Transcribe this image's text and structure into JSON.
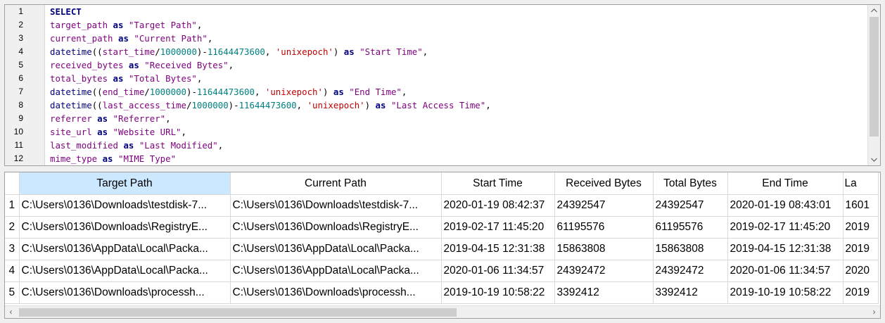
{
  "editor": {
    "line_numbers": [
      "1",
      "2",
      "3",
      "4",
      "5",
      "6",
      "7",
      "8",
      "9",
      "10",
      "11",
      "12"
    ],
    "lines": [
      [
        {
          "t": "SELECT",
          "c": "kw"
        }
      ],
      [
        {
          "t": "target_path",
          "c": "id"
        },
        {
          "t": " as ",
          "c": "kw"
        },
        {
          "t": "\"Target Path\"",
          "c": "str"
        },
        {
          "t": ",",
          "c": "op"
        }
      ],
      [
        {
          "t": "current_path",
          "c": "id"
        },
        {
          "t": " as ",
          "c": "kw"
        },
        {
          "t": "\"Current Path\"",
          "c": "str"
        },
        {
          "t": ",",
          "c": "op"
        }
      ],
      [
        {
          "t": "datetime",
          "c": "fn"
        },
        {
          "t": "((",
          "c": "op"
        },
        {
          "t": "start_time",
          "c": "id"
        },
        {
          "t": "/",
          "c": "op"
        },
        {
          "t": "1000000",
          "c": "num"
        },
        {
          "t": ")-",
          "c": "op"
        },
        {
          "t": "11644473600",
          "c": "num"
        },
        {
          "t": ", ",
          "c": "op"
        },
        {
          "t": "'unixepoch'",
          "c": "sq"
        },
        {
          "t": ")",
          "c": "op"
        },
        {
          "t": " as ",
          "c": "kw"
        },
        {
          "t": "\"Start Time\"",
          "c": "str"
        },
        {
          "t": ",",
          "c": "op"
        }
      ],
      [
        {
          "t": "received_bytes",
          "c": "id"
        },
        {
          "t": " as ",
          "c": "kw"
        },
        {
          "t": "\"Received Bytes\"",
          "c": "str"
        },
        {
          "t": ",",
          "c": "op"
        }
      ],
      [
        {
          "t": "total_bytes",
          "c": "id"
        },
        {
          "t": " as ",
          "c": "kw"
        },
        {
          "t": "\"Total Bytes\"",
          "c": "str"
        },
        {
          "t": ",",
          "c": "op"
        }
      ],
      [
        {
          "t": "datetime",
          "c": "fn"
        },
        {
          "t": "((",
          "c": "op"
        },
        {
          "t": "end_time",
          "c": "id"
        },
        {
          "t": "/",
          "c": "op"
        },
        {
          "t": "1000000",
          "c": "num"
        },
        {
          "t": ")-",
          "c": "op"
        },
        {
          "t": "11644473600",
          "c": "num"
        },
        {
          "t": ", ",
          "c": "op"
        },
        {
          "t": "'unixepoch'",
          "c": "sq"
        },
        {
          "t": ")",
          "c": "op"
        },
        {
          "t": " as ",
          "c": "kw"
        },
        {
          "t": "\"End Time\"",
          "c": "str"
        },
        {
          "t": ",",
          "c": "op"
        }
      ],
      [
        {
          "t": "datetime",
          "c": "fn"
        },
        {
          "t": "((",
          "c": "op"
        },
        {
          "t": "last_access_time",
          "c": "id"
        },
        {
          "t": "/",
          "c": "op"
        },
        {
          "t": "1000000",
          "c": "num"
        },
        {
          "t": ")-",
          "c": "op"
        },
        {
          "t": "11644473600",
          "c": "num"
        },
        {
          "t": ", ",
          "c": "op"
        },
        {
          "t": "'unixepoch'",
          "c": "sq"
        },
        {
          "t": ")",
          "c": "op"
        },
        {
          "t": " as ",
          "c": "kw"
        },
        {
          "t": "\"Last Access Time\"",
          "c": "str"
        },
        {
          "t": ",",
          "c": "op"
        }
      ],
      [
        {
          "t": "referrer",
          "c": "id"
        },
        {
          "t": " as ",
          "c": "kw"
        },
        {
          "t": "\"Referrer\"",
          "c": "str"
        },
        {
          "t": ",",
          "c": "op"
        }
      ],
      [
        {
          "t": "site_url",
          "c": "id"
        },
        {
          "t": " as ",
          "c": "kw"
        },
        {
          "t": "\"Website URL\"",
          "c": "str"
        },
        {
          "t": ",",
          "c": "op"
        }
      ],
      [
        {
          "t": "last_modified",
          "c": "id"
        },
        {
          "t": " as ",
          "c": "kw"
        },
        {
          "t": "\"Last Modified\"",
          "c": "str"
        },
        {
          "t": ",",
          "c": "op"
        }
      ],
      [
        {
          "t": "mime_type",
          "c": "id"
        },
        {
          "t": " as ",
          "c": "kw"
        },
        {
          "t": "\"MIME Type\"",
          "c": "str"
        }
      ]
    ],
    "icons": {
      "up": "arrow-up-icon",
      "down": "arrow-down-icon"
    }
  },
  "results": {
    "columns": [
      "Target Path",
      "Current Path",
      "Start Time",
      "Received Bytes",
      "Total Bytes",
      "End Time",
      "La"
    ],
    "rows": [
      {
        "num": "1",
        "cells": [
          "C:\\Users\\0136\\Downloads\\testdisk-7...",
          "C:\\Users\\0136\\Downloads\\testdisk-7...",
          "2020-01-19 08:42:37",
          "24392547",
          "24392547",
          "2020-01-19 08:43:01",
          "1601"
        ]
      },
      {
        "num": "2",
        "cells": [
          "C:\\Users\\0136\\Downloads\\RegistryE...",
          "C:\\Users\\0136\\Downloads\\RegistryE...",
          "2019-02-17 11:45:20",
          "61195576",
          "61195576",
          "2019-02-17 11:45:20",
          "2019"
        ]
      },
      {
        "num": "3",
        "cells": [
          "C:\\Users\\0136\\AppData\\Local\\Packa...",
          "C:\\Users\\0136\\AppData\\Local\\Packa...",
          "2019-04-15 12:31:38",
          "15863808",
          "15863808",
          "2019-04-15 12:31:38",
          "2019"
        ]
      },
      {
        "num": "4",
        "cells": [
          "C:\\Users\\0136\\AppData\\Local\\Packa...",
          "C:\\Users\\0136\\AppData\\Local\\Packa...",
          "2020-01-06 11:34:57",
          "24392472",
          "24392472",
          "2020-01-06 11:34:57",
          "2020"
        ]
      },
      {
        "num": "5",
        "cells": [
          "C:\\Users\\0136\\Downloads\\processh...",
          "C:\\Users\\0136\\Downloads\\processh...",
          "2019-10-19 10:58:22",
          "3392412",
          "3392412",
          "2019-10-19 10:58:22",
          "2019"
        ]
      }
    ],
    "scroll_left_glyph": "‹",
    "scroll_right_glyph": "›"
  },
  "scroll_glyphs": {
    "up": "^",
    "down": "v"
  },
  "colors": {
    "keyword": "#00007f",
    "identifier": "#7f007f",
    "string_single": "#c00000",
    "number": "#008080",
    "active_header": "#cce8ff"
  }
}
